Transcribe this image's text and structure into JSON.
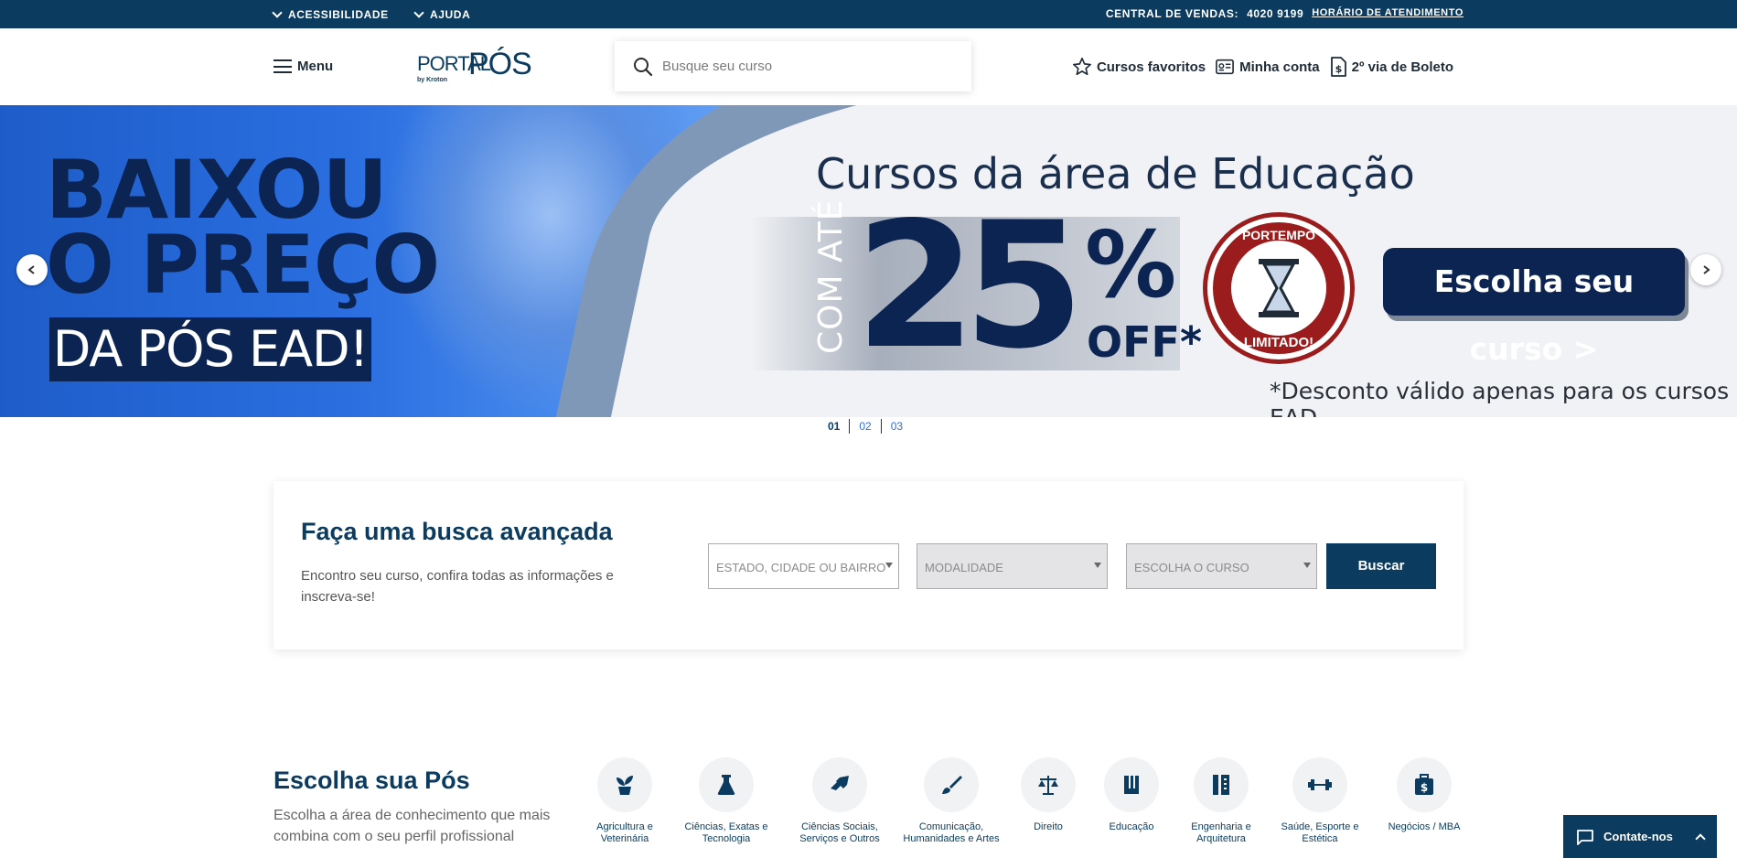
{
  "topbar": {
    "acessibilidade": "ACESSIBILIDADE",
    "ajuda": "AJUDA",
    "central_label": "CENTRAL DE VENDAS:",
    "central_phone": "4020 9199",
    "horario": "HORÁRIO DE ATENDIMENTO"
  },
  "header": {
    "menu_label": "Menu",
    "logo_portal": "PORTAL",
    "logo_pos": "PÓS",
    "logo_by": "by Kroton",
    "search_placeholder": "Busque seu curso",
    "favoritos": "Cursos favoritos",
    "minha_conta": "Minha conta",
    "boleto": "2º via de Boleto"
  },
  "banner": {
    "headline_1": "BAIXOU",
    "headline_2": "O PREÇO",
    "headline_pill": "DA PÓS EAD!",
    "area_title": "Cursos da área de Educação",
    "com_ate": "COM ATÉ",
    "discount_number": "25",
    "discount_pct": "%",
    "discount_off": "OFF*",
    "seal_top": "PORTEMPO",
    "seal_bottom": "LIMITADO!",
    "cta": "Escolha seu curso >",
    "disclaimer": "*Desconto válido apenas para os cursos EAD.",
    "slides": [
      "01",
      "02",
      "03"
    ],
    "active_slide": 0
  },
  "advanced_search": {
    "title": "Faça uma busca avançada",
    "description": "Encontro seu curso, confira todas as informações e inscreva-se!",
    "location_placeholder": "ESTADO, CIDADE OU BAIRRO",
    "modalidade_placeholder": "MODALIDADE",
    "curso_placeholder": "ESCOLHA O CURSO",
    "button": "Buscar"
  },
  "categories": {
    "title": "Escolha sua Pós",
    "subtitle": "Escolha a área de conhecimento que mais combina com o seu perfil profissional",
    "items": [
      {
        "label": "Agricultura e Veterinária",
        "icon": "plant-icon"
      },
      {
        "label": "Ciências, Exatas e Tecnologia",
        "icon": "flask-icon"
      },
      {
        "label": "Ciências Sociais, Serviços e Outros",
        "icon": "handshake-icon"
      },
      {
        "label": "Comunicação, Humanidades e Artes",
        "icon": "brush-icon"
      },
      {
        "label": "Direito",
        "icon": "scale-icon"
      },
      {
        "label": "Educação",
        "icon": "book-icon"
      },
      {
        "label": "Engenharia e Arquitetura",
        "icon": "ruler-icon"
      },
      {
        "label": "Saúde, Esporte e Estética",
        "icon": "dumbbell-icon"
      },
      {
        "label": "Negócios / MBA",
        "icon": "briefcase-icon"
      }
    ]
  },
  "chat": {
    "label": "Contate-nos"
  },
  "colors": {
    "navy": "#0b3b5e",
    "banner_blue": "#2a6ee0",
    "seal_red": "#9b1c1c"
  }
}
